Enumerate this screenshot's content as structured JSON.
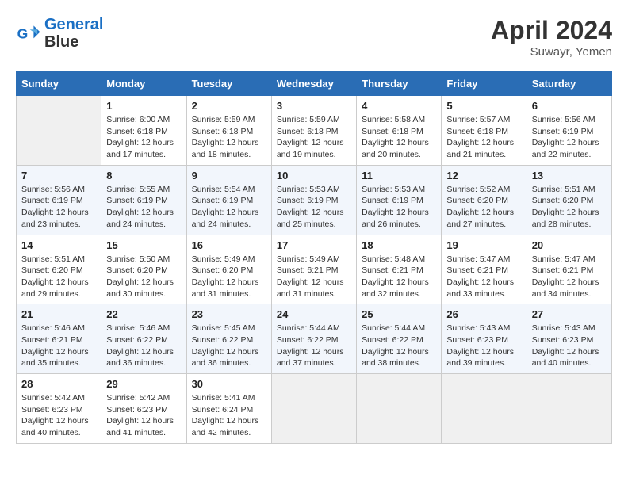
{
  "header": {
    "logo_line1": "General",
    "logo_line2": "Blue",
    "month": "April 2024",
    "location": "Suwayr, Yemen"
  },
  "columns": [
    "Sunday",
    "Monday",
    "Tuesday",
    "Wednesday",
    "Thursday",
    "Friday",
    "Saturday"
  ],
  "weeks": [
    [
      {
        "day": "",
        "empty": true
      },
      {
        "day": "1",
        "sunrise": "6:00 AM",
        "sunset": "6:18 PM",
        "daylight": "12 hours and 17 minutes."
      },
      {
        "day": "2",
        "sunrise": "5:59 AM",
        "sunset": "6:18 PM",
        "daylight": "12 hours and 18 minutes."
      },
      {
        "day": "3",
        "sunrise": "5:59 AM",
        "sunset": "6:18 PM",
        "daylight": "12 hours and 19 minutes."
      },
      {
        "day": "4",
        "sunrise": "5:58 AM",
        "sunset": "6:18 PM",
        "daylight": "12 hours and 20 minutes."
      },
      {
        "day": "5",
        "sunrise": "5:57 AM",
        "sunset": "6:18 PM",
        "daylight": "12 hours and 21 minutes."
      },
      {
        "day": "6",
        "sunrise": "5:56 AM",
        "sunset": "6:19 PM",
        "daylight": "12 hours and 22 minutes."
      }
    ],
    [
      {
        "day": "7",
        "sunrise": "5:56 AM",
        "sunset": "6:19 PM",
        "daylight": "12 hours and 23 minutes."
      },
      {
        "day": "8",
        "sunrise": "5:55 AM",
        "sunset": "6:19 PM",
        "daylight": "12 hours and 24 minutes."
      },
      {
        "day": "9",
        "sunrise": "5:54 AM",
        "sunset": "6:19 PM",
        "daylight": "12 hours and 24 minutes."
      },
      {
        "day": "10",
        "sunrise": "5:53 AM",
        "sunset": "6:19 PM",
        "daylight": "12 hours and 25 minutes."
      },
      {
        "day": "11",
        "sunrise": "5:53 AM",
        "sunset": "6:19 PM",
        "daylight": "12 hours and 26 minutes."
      },
      {
        "day": "12",
        "sunrise": "5:52 AM",
        "sunset": "6:20 PM",
        "daylight": "12 hours and 27 minutes."
      },
      {
        "day": "13",
        "sunrise": "5:51 AM",
        "sunset": "6:20 PM",
        "daylight": "12 hours and 28 minutes."
      }
    ],
    [
      {
        "day": "14",
        "sunrise": "5:51 AM",
        "sunset": "6:20 PM",
        "daylight": "12 hours and 29 minutes."
      },
      {
        "day": "15",
        "sunrise": "5:50 AM",
        "sunset": "6:20 PM",
        "daylight": "12 hours and 30 minutes."
      },
      {
        "day": "16",
        "sunrise": "5:49 AM",
        "sunset": "6:20 PM",
        "daylight": "12 hours and 31 minutes."
      },
      {
        "day": "17",
        "sunrise": "5:49 AM",
        "sunset": "6:21 PM",
        "daylight": "12 hours and 31 minutes."
      },
      {
        "day": "18",
        "sunrise": "5:48 AM",
        "sunset": "6:21 PM",
        "daylight": "12 hours and 32 minutes."
      },
      {
        "day": "19",
        "sunrise": "5:47 AM",
        "sunset": "6:21 PM",
        "daylight": "12 hours and 33 minutes."
      },
      {
        "day": "20",
        "sunrise": "5:47 AM",
        "sunset": "6:21 PM",
        "daylight": "12 hours and 34 minutes."
      }
    ],
    [
      {
        "day": "21",
        "sunrise": "5:46 AM",
        "sunset": "6:21 PM",
        "daylight": "12 hours and 35 minutes."
      },
      {
        "day": "22",
        "sunrise": "5:46 AM",
        "sunset": "6:22 PM",
        "daylight": "12 hours and 36 minutes."
      },
      {
        "day": "23",
        "sunrise": "5:45 AM",
        "sunset": "6:22 PM",
        "daylight": "12 hours and 36 minutes."
      },
      {
        "day": "24",
        "sunrise": "5:44 AM",
        "sunset": "6:22 PM",
        "daylight": "12 hours and 37 minutes."
      },
      {
        "day": "25",
        "sunrise": "5:44 AM",
        "sunset": "6:22 PM",
        "daylight": "12 hours and 38 minutes."
      },
      {
        "day": "26",
        "sunrise": "5:43 AM",
        "sunset": "6:23 PM",
        "daylight": "12 hours and 39 minutes."
      },
      {
        "day": "27",
        "sunrise": "5:43 AM",
        "sunset": "6:23 PM",
        "daylight": "12 hours and 40 minutes."
      }
    ],
    [
      {
        "day": "28",
        "sunrise": "5:42 AM",
        "sunset": "6:23 PM",
        "daylight": "12 hours and 40 minutes."
      },
      {
        "day": "29",
        "sunrise": "5:42 AM",
        "sunset": "6:23 PM",
        "daylight": "12 hours and 41 minutes."
      },
      {
        "day": "30",
        "sunrise": "5:41 AM",
        "sunset": "6:24 PM",
        "daylight": "12 hours and 42 minutes."
      },
      {
        "day": "",
        "empty": true
      },
      {
        "day": "",
        "empty": true
      },
      {
        "day": "",
        "empty": true
      },
      {
        "day": "",
        "empty": true
      }
    ]
  ],
  "labels": {
    "sunrise": "Sunrise:",
    "sunset": "Sunset:",
    "daylight": "Daylight:"
  }
}
